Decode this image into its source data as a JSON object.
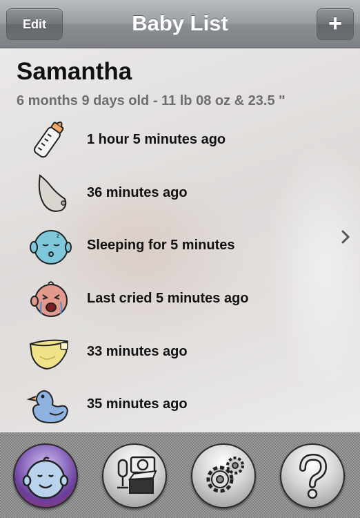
{
  "navbar": {
    "title": "Baby List",
    "edit_label": "Edit",
    "add_label": "+"
  },
  "baby": {
    "name": "Samantha",
    "info": "6 months 9 days old - 11 lb 08 oz & 23.5 \""
  },
  "events": [
    {
      "icon": "bottle-icon",
      "text": "1 hour 5 minutes ago"
    },
    {
      "icon": "nursing-icon",
      "text": "36 minutes ago"
    },
    {
      "icon": "sleeping-baby-icon",
      "text": "Sleeping for 5 minutes"
    },
    {
      "icon": "crying-baby-icon",
      "text": "Last cried 5 minutes ago"
    },
    {
      "icon": "diaper-icon",
      "text": "33 minutes ago"
    },
    {
      "icon": "rubber-duck-icon",
      "text": "35 minutes ago"
    }
  ],
  "tabbar": {
    "tabs": [
      "baby-face-icon",
      "media-icon",
      "gears-icon",
      "question-mark-icon"
    ]
  },
  "colors": {
    "navbar": "#9a9ea3",
    "sleep_face": "#7fc8dc",
    "cry_face": "#e39a8c",
    "diaper": "#f1e38a",
    "duck": "#8fb3e0",
    "tab_baby": "#6a3f9a"
  }
}
